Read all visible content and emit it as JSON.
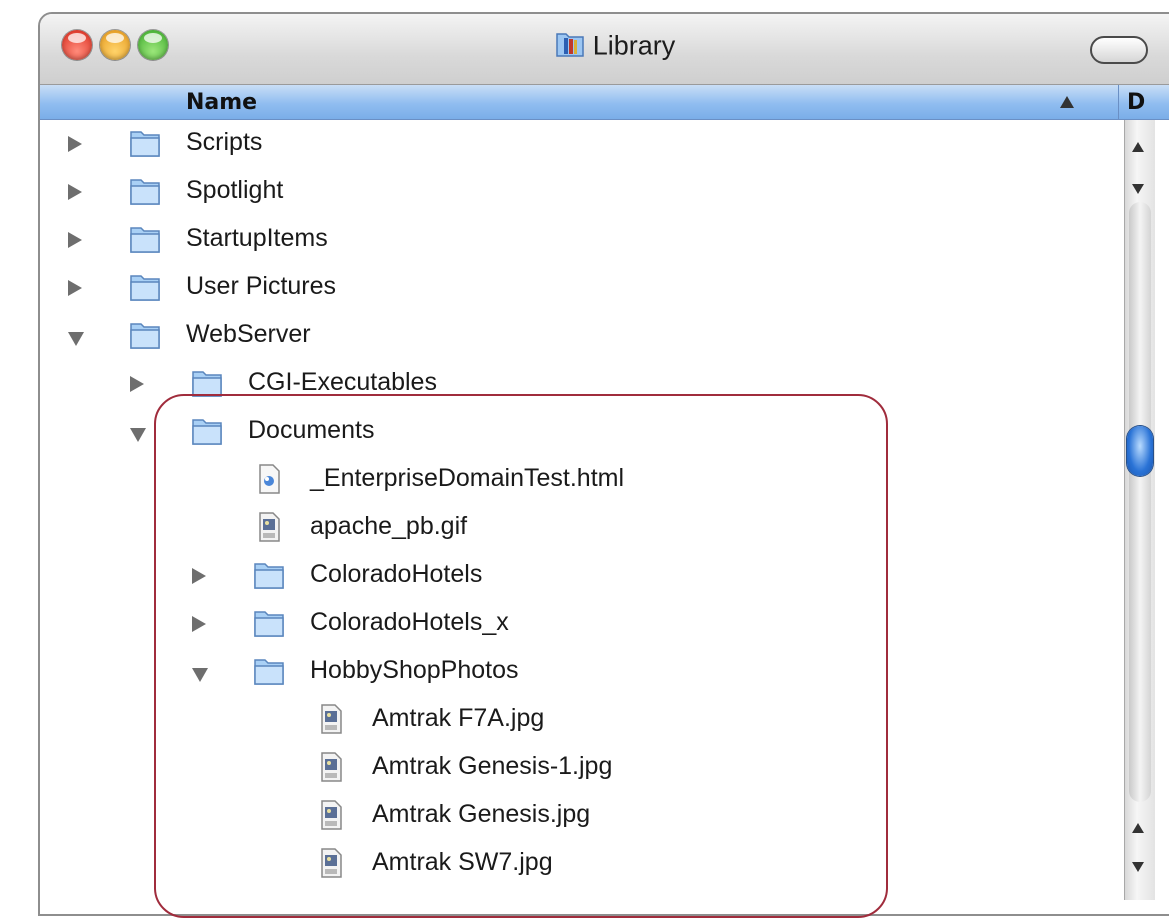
{
  "window": {
    "title": "Library"
  },
  "header": {
    "name_column": "Name",
    "next_column_fragment": "D"
  },
  "colors": {
    "header_blue": "#90bdf0",
    "scroll_thumb": "#2a73d6",
    "highlight_border": "#a02c3c"
  },
  "rows": [
    {
      "label": "Scripts",
      "kind": "folder",
      "level": 0,
      "disclosure": "collapsed"
    },
    {
      "label": "Spotlight",
      "kind": "folder",
      "level": 0,
      "disclosure": "collapsed"
    },
    {
      "label": "StartupItems",
      "kind": "folder",
      "level": 0,
      "disclosure": "collapsed"
    },
    {
      "label": "User Pictures",
      "kind": "folder",
      "level": 0,
      "disclosure": "collapsed"
    },
    {
      "label": "WebServer",
      "kind": "folder",
      "level": 0,
      "disclosure": "expanded"
    },
    {
      "label": "CGI-Executables",
      "kind": "folder",
      "level": 1,
      "disclosure": "collapsed"
    },
    {
      "label": "Documents",
      "kind": "folder",
      "level": 1,
      "disclosure": "expanded"
    },
    {
      "label": "_EnterpriseDomainTest.html",
      "kind": "html-file",
      "level": 2,
      "disclosure": "none"
    },
    {
      "label": "apache_pb.gif",
      "kind": "image-file",
      "level": 2,
      "disclosure": "none"
    },
    {
      "label": "ColoradoHotels",
      "kind": "folder",
      "level": 2,
      "disclosure": "collapsed"
    },
    {
      "label": "ColoradoHotels_x",
      "kind": "folder",
      "level": 2,
      "disclosure": "collapsed"
    },
    {
      "label": "HobbyShopPhotos",
      "kind": "folder",
      "level": 2,
      "disclosure": "expanded"
    },
    {
      "label": "Amtrak F7A.jpg",
      "kind": "image-file",
      "level": 3,
      "disclosure": "none"
    },
    {
      "label": "Amtrak Genesis-1.jpg",
      "kind": "image-file",
      "level": 3,
      "disclosure": "none"
    },
    {
      "label": "Amtrak Genesis.jpg",
      "kind": "image-file",
      "level": 3,
      "disclosure": "none"
    },
    {
      "label": "Amtrak SW7.jpg",
      "kind": "image-file",
      "level": 3,
      "disclosure": "none"
    }
  ]
}
